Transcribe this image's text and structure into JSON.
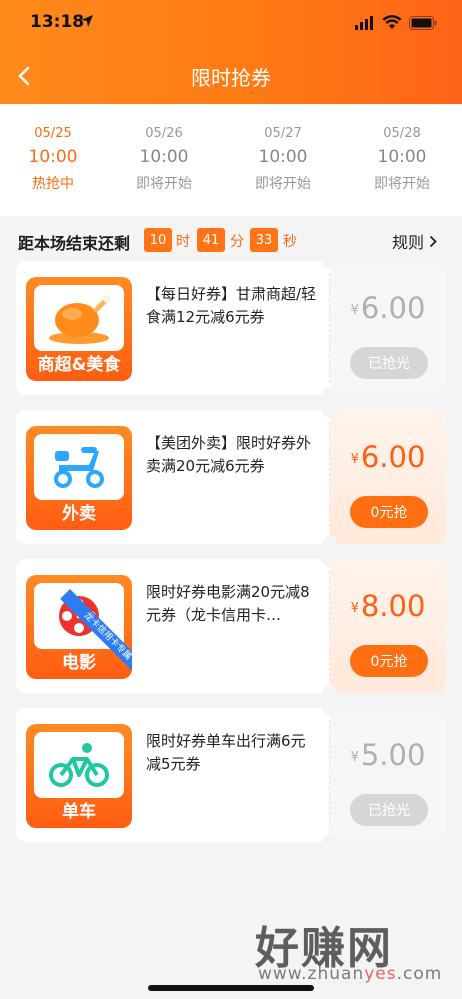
{
  "status_bar": {
    "time": "13:18"
  },
  "header": {
    "title": "限时抢券"
  },
  "tabs": [
    {
      "date": "05/25",
      "time": "10:00",
      "status": "热抢中",
      "active": true
    },
    {
      "date": "05/26",
      "time": "10:00",
      "status": "即将开始",
      "active": false
    },
    {
      "date": "05/27",
      "time": "10:00",
      "status": "即将开始",
      "active": false
    },
    {
      "date": "05/28",
      "time": "10:00",
      "status": "即将开始",
      "active": false
    }
  ],
  "countdown": {
    "label": "距本场结束还剩",
    "hours": "10",
    "hours_unit": "时",
    "minutes": "41",
    "minutes_unit": "分",
    "seconds": "33",
    "seconds_unit": "秒",
    "rules_label": "规则"
  },
  "coupons": [
    {
      "category": "商超&美食",
      "icon": "roast-chicken-icon",
      "title": "【每日好券】甘肃商超/轻食满12元减6元券",
      "currency": "¥",
      "price": "6.00",
      "button": "已抢光",
      "state": "sold_out"
    },
    {
      "category": "外卖",
      "icon": "scooter-icon",
      "title": "【美团外卖】限时好券外卖满20元减6元券",
      "currency": "¥",
      "price": "6.00",
      "button": "0元抢",
      "state": "available"
    },
    {
      "category": "电影",
      "icon": "film-reel-icon",
      "ribbon": "龙卡信用卡专属",
      "title": "限时好券电影满20元减8元券（龙卡信用卡…",
      "currency": "¥",
      "price": "8.00",
      "button": "0元抢",
      "state": "available"
    },
    {
      "category": "单车",
      "icon": "bicycle-icon",
      "title": "限时好券单车出行满6元减5元券",
      "currency": "¥",
      "price": "5.00",
      "button": "已抢光",
      "state": "sold_out"
    }
  ],
  "watermark": {
    "text": "好赚网",
    "url_pre": "www.zhuan",
    "url_hl": "yes",
    "url_post": ".com"
  },
  "colors": {
    "accent": "#ff6a13",
    "header_gradient_start": "#ff8a1c",
    "header_gradient_end": "#ff6418",
    "disabled": "#d6d6d6"
  }
}
